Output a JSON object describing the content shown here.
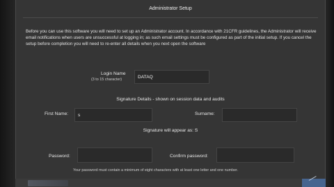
{
  "window": {
    "title": "Administrator Setup"
  },
  "intro": {
    "text": "Before you can use this software you will need to set up an Administrator account. In accordance with 21CFR guidelines, the Administrator will receive email notifications when users are unsuccessful at logging in; as such email settings must be configured as part of the initial setup. If you cancel the setup before completion you will need to re-enter all details when you next open the software"
  },
  "login": {
    "label": "Login Name",
    "hint": "(3 to 15 character)",
    "value": "DATAQ"
  },
  "signature": {
    "section_title": "Signature Details - shown on session data and audits",
    "first_name_label": "First Name:",
    "first_name_value": "s",
    "surname_label": "Surname:",
    "surname_value": "",
    "preview_text": "Signature will appear as: S"
  },
  "password": {
    "password_label": "Password:",
    "password_value": "",
    "confirm_label": "Confirm password:",
    "confirm_value": "",
    "requirement_text": "Your password must contain a minimum of eight characters with at least one letter and one number."
  }
}
